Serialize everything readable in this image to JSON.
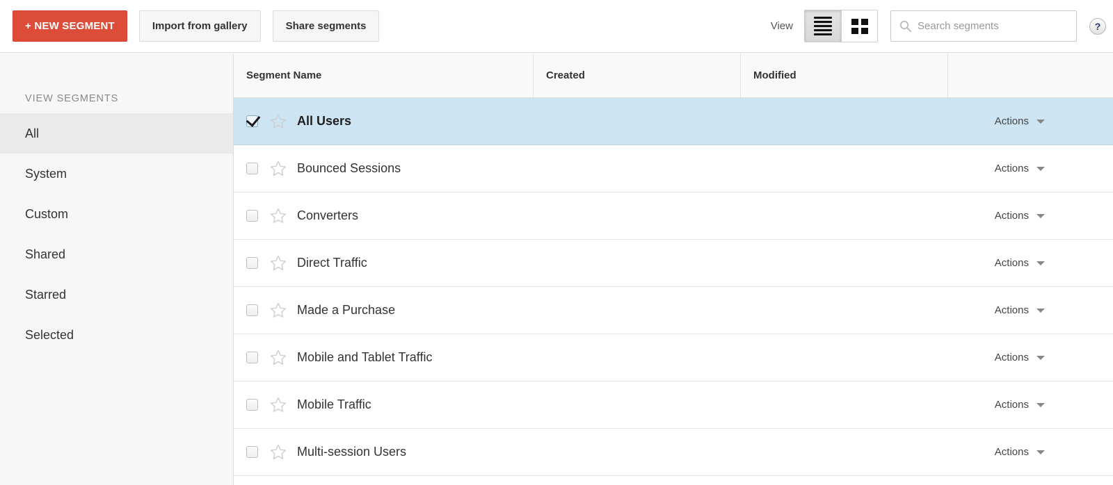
{
  "toolbar": {
    "new_segment_label": "+ NEW SEGMENT",
    "import_label": "Import from gallery",
    "share_label": "Share segments",
    "view_label": "View",
    "list_view_icon": "list-view-icon",
    "grid_view_icon": "grid-view-icon",
    "active_view": "list",
    "search_placeholder": "Search segments",
    "search_value": "",
    "search_icon": "search-icon",
    "help_label": "?",
    "accent_color": "#dd4b39"
  },
  "sidebar": {
    "title": "VIEW SEGMENTS",
    "active_item": "All",
    "items": [
      {
        "label": "All"
      },
      {
        "label": "System"
      },
      {
        "label": "Custom"
      },
      {
        "label": "Shared"
      },
      {
        "label": "Starred"
      },
      {
        "label": "Selected"
      }
    ]
  },
  "table": {
    "columns": [
      {
        "label": "Segment Name"
      },
      {
        "label": "Created"
      },
      {
        "label": "Modified"
      },
      {
        "label": ""
      }
    ],
    "actions_label": "Actions",
    "selected_row_color": "#cde4f3",
    "rows": [
      {
        "name": "All Users",
        "checked": true,
        "starred": false,
        "created": "",
        "modified": "",
        "actions": "Actions"
      },
      {
        "name": "Bounced Sessions",
        "checked": false,
        "starred": false,
        "created": "",
        "modified": "",
        "actions": "Actions"
      },
      {
        "name": "Converters",
        "checked": false,
        "starred": false,
        "created": "",
        "modified": "",
        "actions": "Actions"
      },
      {
        "name": "Direct Traffic",
        "checked": false,
        "starred": false,
        "created": "",
        "modified": "",
        "actions": "Actions"
      },
      {
        "name": "Made a Purchase",
        "checked": false,
        "starred": false,
        "created": "",
        "modified": "",
        "actions": "Actions"
      },
      {
        "name": "Mobile and Tablet Traffic",
        "checked": false,
        "starred": false,
        "created": "",
        "modified": "",
        "actions": "Actions"
      },
      {
        "name": "Mobile Traffic",
        "checked": false,
        "starred": false,
        "created": "",
        "modified": "",
        "actions": "Actions"
      },
      {
        "name": "Multi-session Users",
        "checked": false,
        "starred": false,
        "created": "",
        "modified": "",
        "actions": "Actions"
      }
    ]
  }
}
